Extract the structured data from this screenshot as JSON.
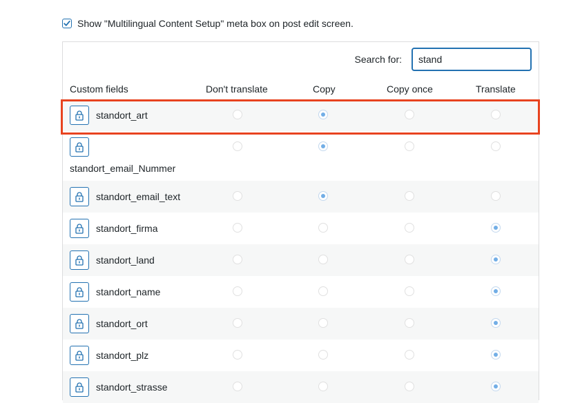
{
  "meta_box_option": {
    "label": "Show \"Multilingual Content Setup\" meta box on post edit screen.",
    "checked": true
  },
  "search": {
    "label": "Search for:",
    "value": "stand"
  },
  "table": {
    "columns": [
      "Custom fields",
      "Don't translate",
      "Copy",
      "Copy once",
      "Translate"
    ],
    "rows": [
      {
        "name": "standort_art",
        "selected": "Copy"
      },
      {
        "name": "standort_email_Nummer",
        "selected": "Copy"
      },
      {
        "name": "standort_email_text",
        "selected": "Copy"
      },
      {
        "name": "standort_firma",
        "selected": "Translate"
      },
      {
        "name": "standort_land",
        "selected": "Translate"
      },
      {
        "name": "standort_name",
        "selected": "Translate"
      },
      {
        "name": "standort_ort",
        "selected": "Translate"
      },
      {
        "name": "standort_plz",
        "selected": "Translate"
      },
      {
        "name": "standort_strasse",
        "selected": "Translate"
      }
    ]
  },
  "icons": {
    "row_lock": "lock-icon",
    "checkbox": "checkmark-icon"
  },
  "colors": {
    "accent": "#2271b1",
    "highlight": "#e8431f",
    "radio_selected": "#72aee6"
  }
}
